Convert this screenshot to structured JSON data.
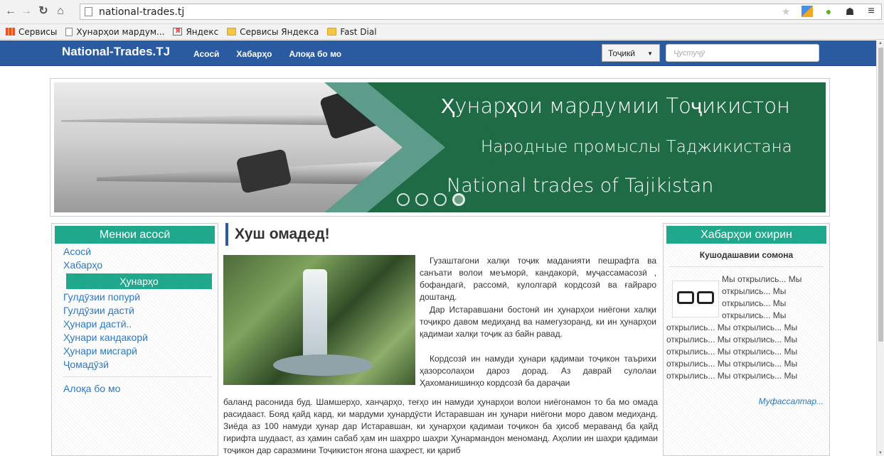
{
  "browser": {
    "url": "national-trades.tj",
    "bookmarks": [
      "Сервисы",
      "Хунарҳои мардум...",
      "Яндекс",
      "Сервисы Яндекса",
      "Fast Dial"
    ]
  },
  "site_nav": {
    "brand": "National-Trades.TJ",
    "links": [
      "Асосӣ",
      "Хабарҳо",
      "Алоқа бо мо"
    ],
    "language": "Тоҷикӣ",
    "search_placeholder": "Ҷустуҷӯ"
  },
  "banner": {
    "line1": "Ҳунарҳои мардумии Тоҷикистон",
    "line2": "Народные промыслы Таджикистана",
    "line3": "National trades of Tajikistan",
    "slide_count": 4,
    "active_slide": 4
  },
  "left_menu": {
    "title": "Менюи асосӣ",
    "top_links": [
      "Асосӣ",
      "Хабарҳо"
    ],
    "crafts_title": "Ҳунарҳо",
    "craft_links": [
      "Гулдӯзии попурӣ",
      "Гулдӯзии дастӣ",
      "Ҳунари дастӣ..",
      "Ҳунари кандакорӣ",
      "Ҳунари мисгарӣ",
      "Ҷомадӯзӣ"
    ],
    "bottom_link": "Алоқа бо мо"
  },
  "main": {
    "title": "Хуш омадед!",
    "p1": "Гузаштагони халқи тоҷик маданияти пешрафта ва санъати волои меъморӣ, кандакорӣ, муҷассамасозӣ , бофандагӣ, рассомӣ, кулолгарӣ кордсозӣ ва ғайраро доштанд.",
    "p2": "Дар Истаравшани бостонӣ ин ҳунарҳои ниёгони халқи тоҷикро давом медиҳанд ва намегузоранд, ки ин ҳунарҳои қадимаи халқи тоҷик аз байн равад.",
    "p3": "Кордсозӣ ин намуди ҳунари қадимаи тоҷикон таърихи ҳазорсолаҳои дароз дорад. Аз даврай сулолаи Ҳахоманишинҳо кордсозӣ ба дараҷаи",
    "p4": "баланд расонида буд. Шамшерҳо, ханҷарҳо, теғҳо ин намуди ҳунарҳои волои ниёгонамон то ба мо омада расидааст. Бояд қайд кард, ки мардуми ҳунардӯсти Истаравшан ин ҳунари ниёгони моро давом медиҳанд. Зиёда аз 100 намуди ҳунар дар Истаравшан, ки ҳунарҳои қадимаи тоҷикон ба ҳисоб мераванд ба қайд гирифта шудааст, аз ҳамин сабаб ҳам ин шаҳрро шаҳри Ҳунармандон меноманд. Аҳолии ин шаҳри қадимаи тоҷикон дар саразмини Тоҷикистон ягона шаҳрест, ки қариб"
  },
  "right_panel": {
    "title": "Хабарҳои охирин",
    "news_title": "Кушодашавии сомона",
    "news_text_short": "Мы открылись... Мы открылись... Мы открылись... Мы открылись... Мы",
    "news_text_long": "открылись... Мы открылись... Мы открылись... Мы открылись... Мы открылись... Мы открылись... Мы открылись... Мы открылись... Мы открылись... Мы открылись... Мы",
    "more_link": "Муфассалтар..."
  },
  "colors": {
    "nav_blue": "#2a5aa0",
    "accent_green": "#1fa88b",
    "link_blue": "#2b78c5",
    "banner_green": "#1f6b45"
  }
}
